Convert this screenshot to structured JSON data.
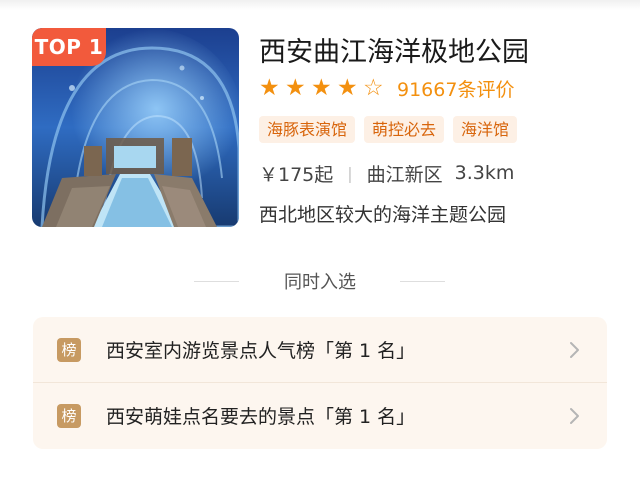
{
  "attraction": {
    "rank_badge": "TOP 1",
    "title": "西安曲江海洋极地公园",
    "rating": {
      "stars_filled": 4,
      "stars_total": 5,
      "star_filled_glyph": "★",
      "star_empty_glyph": "☆",
      "review_count": "91667条评价"
    },
    "tags": [
      "海豚表演馆",
      "萌控必去",
      "海洋馆"
    ],
    "price": "￥175起",
    "separator": "|",
    "district": "曲江新区",
    "distance": "3.3km",
    "description": "西北地区较大的海洋主题公园",
    "image_subject": "underwater aquarium tunnel"
  },
  "also_listed": {
    "heading": "同时入选",
    "items": [
      {
        "icon_char": "榜",
        "text": "西安室内游览景点人气榜「第 1 名」"
      },
      {
        "icon_char": "榜",
        "text": "西安萌娃点名要去的景点「第 1 名」"
      }
    ]
  },
  "colors": {
    "accent_orange": "#f3900f",
    "badge_red": "#f25a3c",
    "tag_bg": "#fdf0e5",
    "tag_text": "#d8650c",
    "panel_bg": "#fdf6ef",
    "rank_icon_bg": "#c79a62"
  },
  "icons": {
    "star": "star-icon",
    "chevron": "chevron-right-icon",
    "rank": "ranking-icon"
  }
}
